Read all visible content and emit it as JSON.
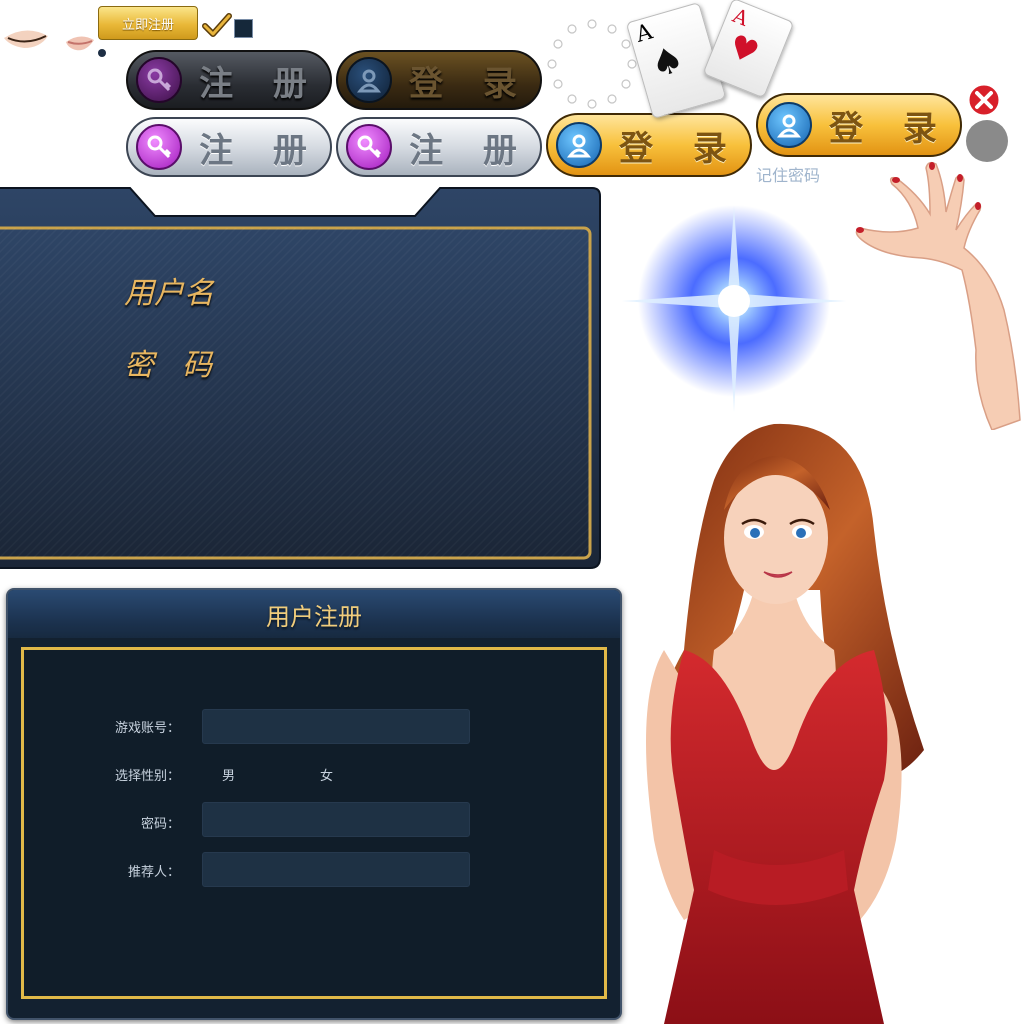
{
  "top_sprites": {
    "register_now_label": "立即注册"
  },
  "buttons": {
    "register_disabled": "注 册",
    "login_disabled": "登 录",
    "register_normal": "注 册",
    "register_hover": "注 册",
    "login_normal": "登 录",
    "login_hover": "登 录"
  },
  "remember_password": "记住密码",
  "cards": [
    {
      "rank": "A",
      "suit": "♠",
      "color": "#111111"
    },
    {
      "rank": "A",
      "suit": "♥",
      "color": "#d0102a"
    }
  ],
  "login_panel": {
    "username_label": "用户名",
    "password_label": "密码"
  },
  "register_panel": {
    "title": "用户注册",
    "account_label": "游戏账号：",
    "gender_label": "选择性别：",
    "gender_male": "男",
    "gender_female": "女",
    "password_label": "密码：",
    "referrer_label": "推荐人："
  },
  "colors": {
    "gold": "#e1b948",
    "panel_dark": "#132130",
    "label_gold": "#e8b660"
  }
}
